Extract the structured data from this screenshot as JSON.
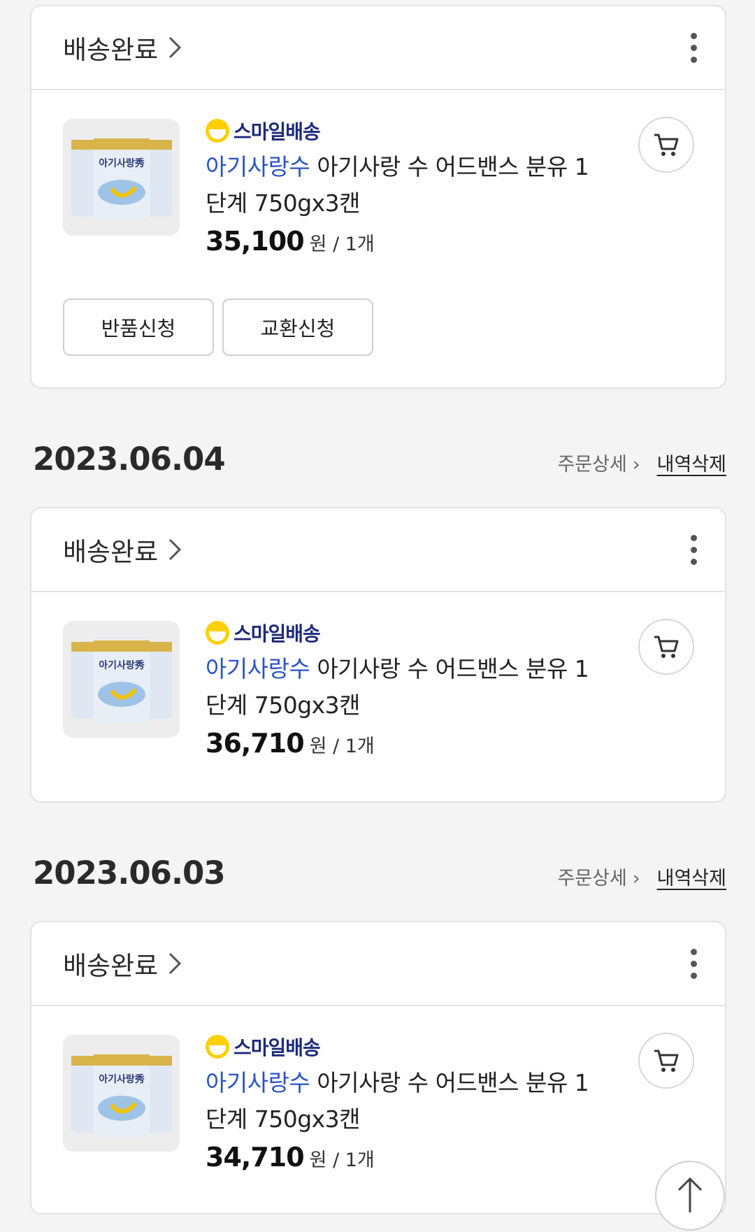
{
  "orders": [
    {
      "status": "배송완료",
      "delivery_badge": "스마일배송",
      "brand": "아기사랑수",
      "product_name": "아기사랑 수 어드밴스 분유 1단계 750gx3캔",
      "price": "35,100",
      "unit": "원 / 1개",
      "return_label": "반품신청",
      "exchange_label": "교환신청"
    },
    {
      "date": "2023.06.04",
      "detail_label": "주문상세",
      "delete_label": "내역삭제",
      "status": "배송완료",
      "delivery_badge": "스마일배송",
      "brand": "아기사랑수",
      "product_name": "아기사랑 수 어드밴스 분유 1단계 750gx3캔",
      "price": "36,710",
      "unit": "원 / 1개"
    },
    {
      "date": "2023.06.03",
      "detail_label": "주문상세",
      "delete_label": "내역삭제",
      "status": "배송완료",
      "delivery_badge": "스마일배송",
      "brand": "아기사랑수",
      "product_name": "아기사랑 수 어드밴스 분유 1단계 750gx3캔",
      "price": "34,710",
      "unit": "원 / 1개"
    }
  ],
  "product_image_text": "아기사랑秀",
  "icons": {
    "status_chevron": "chevron-right-icon",
    "more": "kebab-menu-icon",
    "cart": "cart-icon",
    "scroll_top": "arrow-up-icon"
  },
  "colors": {
    "brand_blue": "#2a53c8",
    "smile_yellow": "#ffcf00",
    "smile_navy": "#1e2a7a"
  }
}
